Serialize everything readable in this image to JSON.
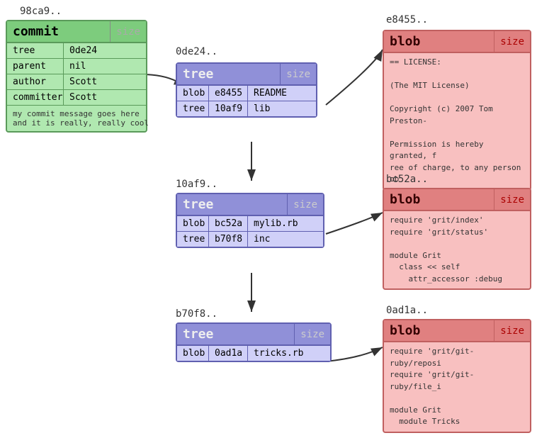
{
  "commit": {
    "hash": "98ca9..",
    "title": "commit",
    "size": "size",
    "rows": [
      {
        "left": "tree",
        "right": "0de24"
      },
      {
        "left": "parent",
        "right": "nil"
      },
      {
        "left": "author",
        "right": "Scott"
      },
      {
        "left": "committer",
        "right": "Scott"
      }
    ],
    "message": "my commit message goes here\nand it is really, really cool"
  },
  "tree1": {
    "hash": "0de24..",
    "title": "tree",
    "size": "size",
    "rows": [
      {
        "left": "blob",
        "mid": "e8455",
        "right": "README"
      },
      {
        "left": "tree",
        "mid": "10af9",
        "right": "lib"
      }
    ]
  },
  "tree2": {
    "hash": "10af9..",
    "title": "tree",
    "size": "size",
    "rows": [
      {
        "left": "blob",
        "mid": "bc52a",
        "right": "mylib.rb"
      },
      {
        "left": "tree",
        "mid": "b70f8",
        "right": "inc"
      }
    ]
  },
  "tree3": {
    "hash": "b70f8..",
    "title": "tree",
    "size": "size",
    "rows": [
      {
        "left": "blob",
        "mid": "0ad1a",
        "right": "tricks.rb"
      }
    ]
  },
  "blob1": {
    "hash": "e8455..",
    "title": "blob",
    "size": "size",
    "content": "== LICENSE:\n\n(The MIT License)\n\nCopyright (c) 2007 Tom Preston-\n\nPermission is hereby granted, f\nree of charge, to any person ob"
  },
  "blob2": {
    "hash": "bc52a..",
    "title": "blob",
    "size": "size",
    "content": "require 'grit/index'\nrequire 'grit/status'\n\nmodule Grit\n  class << self\n    attr_accessor :debug"
  },
  "blob3": {
    "hash": "0ad1a..",
    "title": "blob",
    "size": "size",
    "content": "require 'grit/git-ruby/reposi\nrequire 'grit/git-ruby/file_i\n\nmodule Grit\n  module Tricks"
  }
}
